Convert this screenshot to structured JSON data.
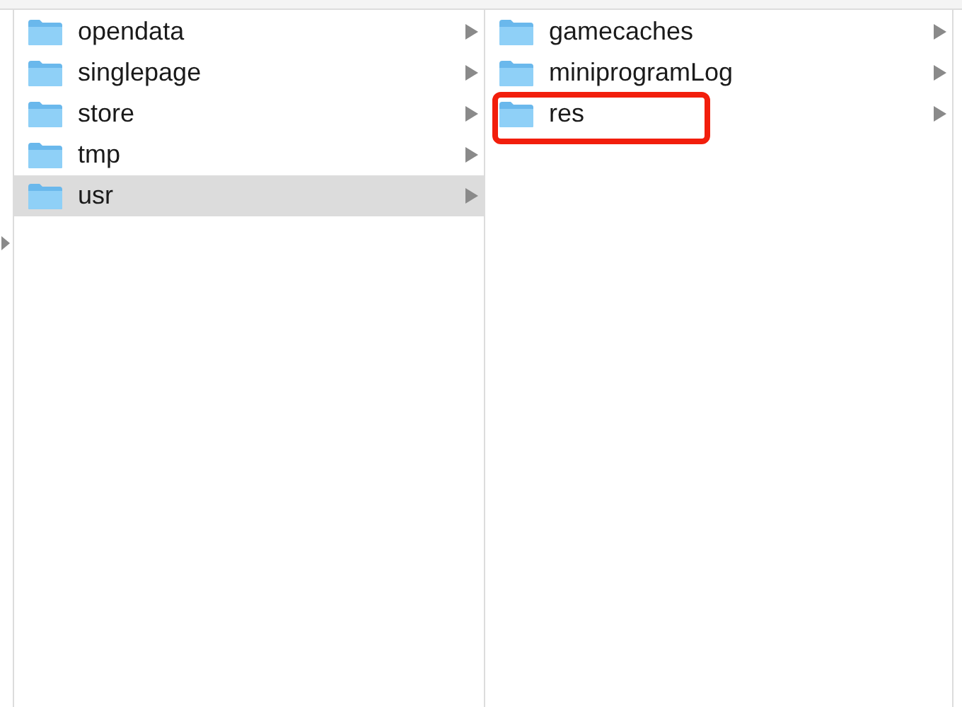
{
  "parent_column": {
    "arrow": true
  },
  "columns": [
    {
      "items": [
        {
          "name": "opendata",
          "selected": false,
          "arrow": true,
          "highlighted": false
        },
        {
          "name": "singlepage",
          "selected": false,
          "arrow": true,
          "highlighted": false
        },
        {
          "name": "store",
          "selected": false,
          "arrow": true,
          "highlighted": false
        },
        {
          "name": "tmp",
          "selected": false,
          "arrow": true,
          "highlighted": false
        },
        {
          "name": "usr",
          "selected": true,
          "arrow": true,
          "highlighted": false
        }
      ]
    },
    {
      "items": [
        {
          "name": "gamecaches",
          "selected": false,
          "arrow": true,
          "highlighted": false
        },
        {
          "name": "miniprogramLog",
          "selected": false,
          "arrow": true,
          "highlighted": false
        },
        {
          "name": "res",
          "selected": false,
          "arrow": true,
          "highlighted": true
        }
      ]
    }
  ]
}
